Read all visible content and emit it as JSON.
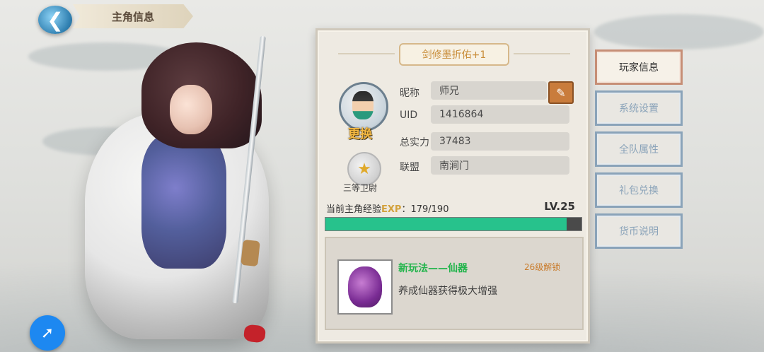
{
  "header": {
    "title": "主角信息"
  },
  "panel": {
    "banner": "剑修墨折佑+1",
    "change_label": "更换",
    "rank_label": "三等卫尉",
    "rows": [
      {
        "label": "昵称",
        "value": "师兄"
      },
      {
        "label": "UID",
        "value": "1416864"
      },
      {
        "label": "总实力",
        "value": "37483"
      },
      {
        "label": "联盟",
        "value": "南涧门"
      }
    ],
    "exp": {
      "label_prefix": "当前主角经验",
      "tag": "EXP",
      "value": "：179/190",
      "current": 179,
      "max": 190
    },
    "level": "LV.25",
    "feature": {
      "title": "新玩法——仙器",
      "lock": "26级解锁",
      "desc": "养成仙器获得极大增强"
    }
  },
  "menu": [
    {
      "label": "玩家信息",
      "active": true
    },
    {
      "label": "系统设置",
      "active": false
    },
    {
      "label": "全队属性",
      "active": false
    },
    {
      "label": "礼包兑换",
      "active": false
    },
    {
      "label": "货币说明",
      "active": false
    }
  ],
  "colors": {
    "exp_fill": "#27c28c",
    "active_border": "#c68e76",
    "inactive_border": "#8aa3b9",
    "feature_title": "#21b44b"
  },
  "icons": {
    "back": "back-arrow-icon",
    "edit": "brush-icon",
    "rank": "rank-badge-icon",
    "compass": "compass-icon"
  }
}
